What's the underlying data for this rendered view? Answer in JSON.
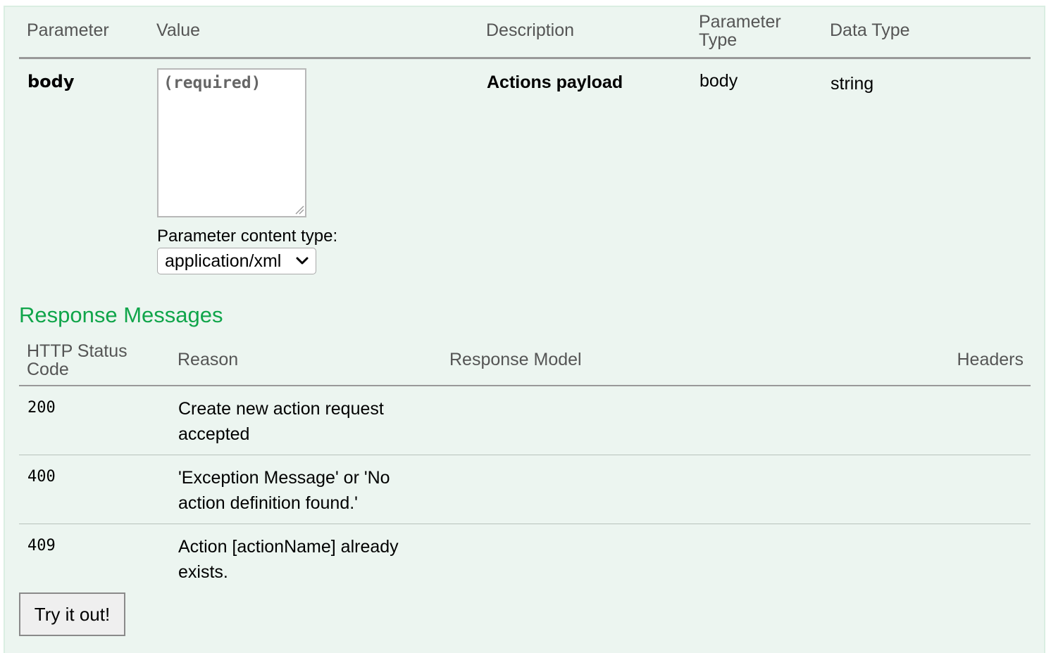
{
  "parameters": {
    "headers": {
      "parameter": "Parameter",
      "value": "Value",
      "description": "Description",
      "parameter_type_line1": "Parameter",
      "parameter_type_line2": "Type",
      "data_type": "Data Type"
    },
    "row": {
      "name": "body",
      "value_placeholder": "(required)",
      "content_type_label": "Parameter content type:",
      "content_type_selected": "application/xml",
      "description": "Actions payload",
      "parameter_type": "body",
      "data_type": "string"
    }
  },
  "responses": {
    "title": "Response Messages",
    "headers": {
      "status_line1": "HTTP Status",
      "status_line2": "Code",
      "reason": "Reason",
      "model": "Response Model",
      "headers": "Headers"
    },
    "rows": [
      {
        "code": "200",
        "reason": "Create new action request accepted"
      },
      {
        "code": "400",
        "reason": "'Exception Message' or 'No action definition found.'"
      },
      {
        "code": "409",
        "reason": "Action [actionName] already exists."
      }
    ]
  },
  "try_button": {
    "label": "Try it out!"
  },
  "colors": {
    "panel_bg": "#ecf5f0",
    "panel_border": "#daeee2",
    "section_title": "#10a54a",
    "header_text": "#555555"
  }
}
